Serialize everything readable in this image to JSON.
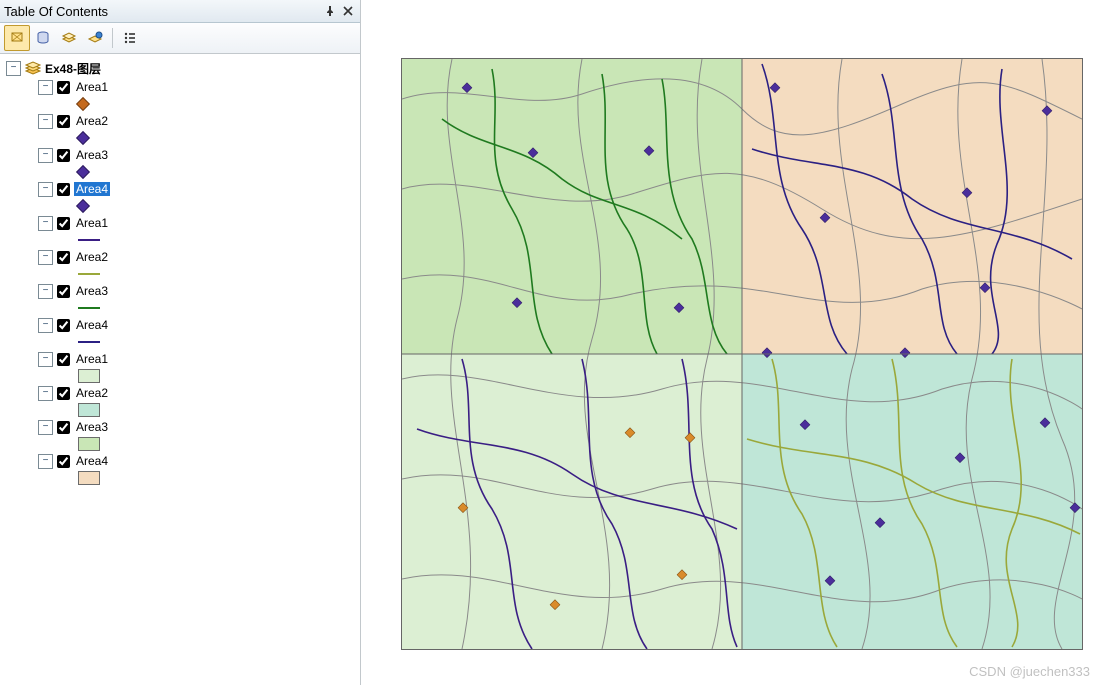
{
  "panel": {
    "title": "Table Of Contents"
  },
  "tree": {
    "root_label": "Ex48-图层",
    "layers": [
      {
        "name": "Area1",
        "type": "point",
        "color": "#c56a1e",
        "checked": true,
        "selected": false
      },
      {
        "name": "Area2",
        "type": "point",
        "color": "#4b2e9b",
        "checked": true,
        "selected": false
      },
      {
        "name": "Area3",
        "type": "point",
        "color": "#4b2e9b",
        "checked": true,
        "selected": false
      },
      {
        "name": "Area4",
        "type": "point",
        "color": "#4b2e9b",
        "checked": true,
        "selected": true
      },
      {
        "name": "Area1",
        "type": "line",
        "color": "#3a1e84",
        "checked": true,
        "selected": false
      },
      {
        "name": "Area2",
        "type": "line",
        "color": "#9aa83a",
        "checked": true,
        "selected": false
      },
      {
        "name": "Area3",
        "type": "line",
        "color": "#1f7a1f",
        "checked": true,
        "selected": false
      },
      {
        "name": "Area4",
        "type": "line",
        "color": "#2b2083",
        "checked": true,
        "selected": false
      },
      {
        "name": "Area1",
        "type": "poly",
        "color": "#dcefd3",
        "checked": true,
        "selected": false
      },
      {
        "name": "Area2",
        "type": "poly",
        "color": "#bfe6d7",
        "checked": true,
        "selected": false
      },
      {
        "name": "Area3",
        "type": "poly",
        "color": "#c9e6b6",
        "checked": true,
        "selected": false
      },
      {
        "name": "Area4",
        "type": "poly",
        "color": "#f4dcc0",
        "checked": true,
        "selected": false
      }
    ]
  },
  "map": {
    "quads": {
      "q1": "#c9e6b6",
      "q2": "#f4dcc0",
      "q3": "#dcefd3",
      "q4": "#bfe6d7"
    }
  },
  "watermark": "CSDN @juechen333"
}
